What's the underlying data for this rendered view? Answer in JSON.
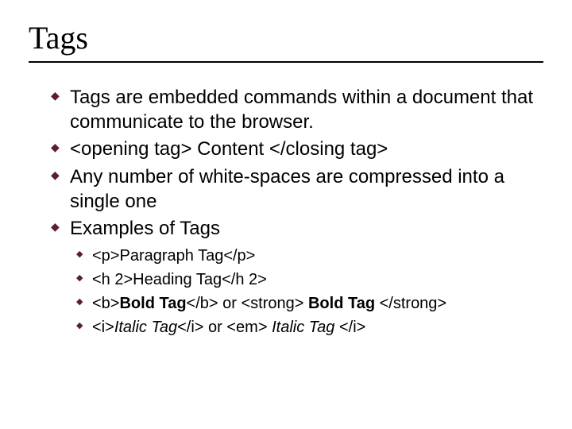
{
  "title": "Tags",
  "bullets": [
    "Tags are embedded commands within a document that communicate to the browser.",
    "<opening tag> Content </closing tag>",
    "Any number of white-spaces are compressed into a single one",
    "Examples of Tags"
  ],
  "sub": [
    {
      "a": "<p>Paragraph Tag</p>",
      "b": ""
    },
    {
      "a": "<h 2>Heading Tag</h 2>",
      "b": ""
    },
    {
      "a": "<b>",
      "b": "Bold Tag",
      "c": "</b> or <strong> ",
      "d": "Bold Tag ",
      "e": "</strong>"
    },
    {
      "a": "<i>",
      "b": "Italic Tag",
      "c": "</i> or <em> ",
      "d": "Italic Tag ",
      "e": "</i>"
    }
  ]
}
